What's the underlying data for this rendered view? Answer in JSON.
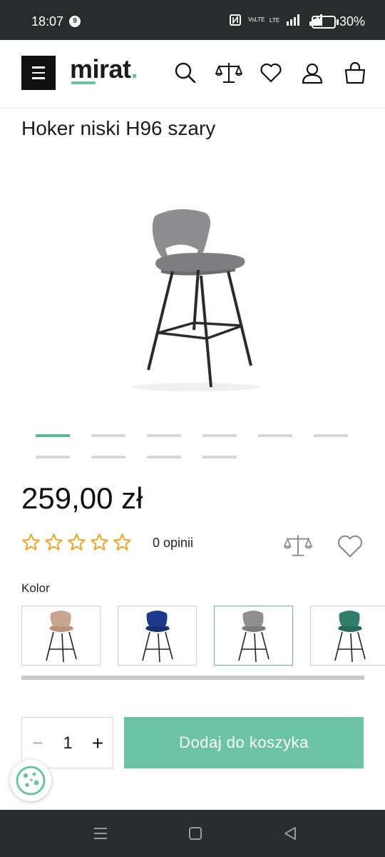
{
  "status_bar": {
    "time": "18:07",
    "notification_count": "9",
    "network_labels": [
      "VoLTE",
      "LTE"
    ],
    "battery_percent": "30%"
  },
  "header": {
    "logo_text": "mirat",
    "logo_dot": ".",
    "icons": [
      "menu-icon",
      "search-icon",
      "compare-icon",
      "heart-icon",
      "user-icon",
      "bag-icon"
    ]
  },
  "product": {
    "title": "Hoker niski H96 szary",
    "price": "259,00 zł",
    "rating_stars": 0,
    "rating_max": 5,
    "opinions": "0 opinii",
    "gallery_count": 10,
    "gallery_active_index": 0
  },
  "colors": {
    "label": "Kolor",
    "swatches": [
      {
        "name": "beige",
        "color": "#c9a58d",
        "selected": false
      },
      {
        "name": "navy",
        "color": "#1d3a8a",
        "selected": false
      },
      {
        "name": "grey",
        "color": "#8f8f8f",
        "selected": true
      },
      {
        "name": "green",
        "color": "#2f7d6a",
        "selected": false
      }
    ]
  },
  "cart": {
    "quantity": "1",
    "minus_label": "−",
    "plus_label": "+",
    "add_button": "Dodaj do koszyka"
  },
  "theme": {
    "accent": "#6cc3a6",
    "dark": "#2a2b2d"
  }
}
